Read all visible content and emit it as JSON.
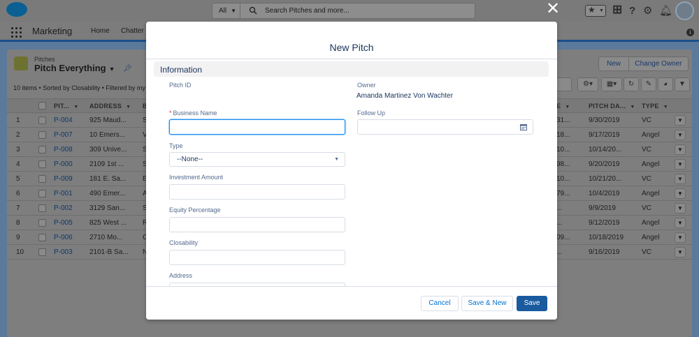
{
  "header": {
    "search_scope": "All",
    "search_placeholder": "Search Pitches and more..."
  },
  "nav": {
    "app_name": "Marketing",
    "items": [
      "Home",
      "Chatter"
    ]
  },
  "list": {
    "object_name": "Pitches",
    "view_name": "Pitch Everything",
    "meta": "10 items • Sorted by Closability • Filtered by my p",
    "buttons": {
      "new": "New",
      "change_owner": "Change Owner"
    },
    "columns": {
      "pitch_id": "PIT...",
      "address": "ADDRESS",
      "b": "B",
      "e": "E",
      "pitch_date": "PITCH DA...",
      "type": "TYPE"
    },
    "rows": [
      {
        "num": "1",
        "pitch_id": "P-004",
        "address": "925 Maud...",
        "b": "S",
        "e": "31...",
        "date": "9/30/2019",
        "type": "VC"
      },
      {
        "num": "2",
        "pitch_id": "P-007",
        "address": "10 Emers...",
        "b": "V",
        "e": "18...",
        "date": "9/17/2019",
        "type": "Angel"
      },
      {
        "num": "3",
        "pitch_id": "P-008",
        "address": "309 Unive...",
        "b": "S",
        "e": "10...",
        "date": "10/14/20...",
        "type": "VC"
      },
      {
        "num": "4",
        "pitch_id": "P-000",
        "address": "2109 1st ...",
        "b": "S",
        "e": "98...",
        "date": "9/20/2019",
        "type": "Angel"
      },
      {
        "num": "5",
        "pitch_id": "P-009",
        "address": "181 E. Sa...",
        "b": "E",
        "e": "10...",
        "date": "10/21/20...",
        "type": "VC"
      },
      {
        "num": "6",
        "pitch_id": "P-001",
        "address": "490 Emer...",
        "b": "A",
        "e": "79...",
        "date": "10/4/2019",
        "type": "Angel"
      },
      {
        "num": "7",
        "pitch_id": "P-002",
        "address": "3129 San...",
        "b": "S",
        "e": "...",
        "date": "9/9/2019",
        "type": "VC"
      },
      {
        "num": "8",
        "pitch_id": "P-005",
        "address": "825 West ...",
        "b": "R",
        "e": "...",
        "date": "9/12/2019",
        "type": "Angel"
      },
      {
        "num": "9",
        "pitch_id": "P-006",
        "address": "2710 Mo...",
        "b": "C",
        "e": "09...",
        "date": "10/18/2019",
        "type": "Angel"
      },
      {
        "num": "10",
        "pitch_id": "P-003",
        "address": "2101-B Sa...",
        "b": "N",
        "e": "...",
        "date": "9/16/2019",
        "type": "VC"
      }
    ]
  },
  "modal": {
    "title": "New Pitch",
    "section": "Information",
    "fields": {
      "pitch_id_label": "Pitch ID",
      "owner_label": "Owner",
      "owner_value": "Amanda Martinez Von Wachter",
      "required_marker": "*",
      "business_name_label": "Business Name",
      "business_name_value": "",
      "follow_up_label": "Follow Up",
      "type_label": "Type",
      "type_value": "--None--",
      "investment_amount_label": "Investment Amount",
      "equity_percentage_label": "Equity Percentage",
      "closability_label": "Closability",
      "address_label": "Address"
    },
    "buttons": {
      "cancel": "Cancel",
      "save_new": "Save & New",
      "save": "Save"
    }
  },
  "colors": {
    "brand": "#0070d2",
    "header_dimmed": "#7a7a7a",
    "required": "#c23934"
  }
}
